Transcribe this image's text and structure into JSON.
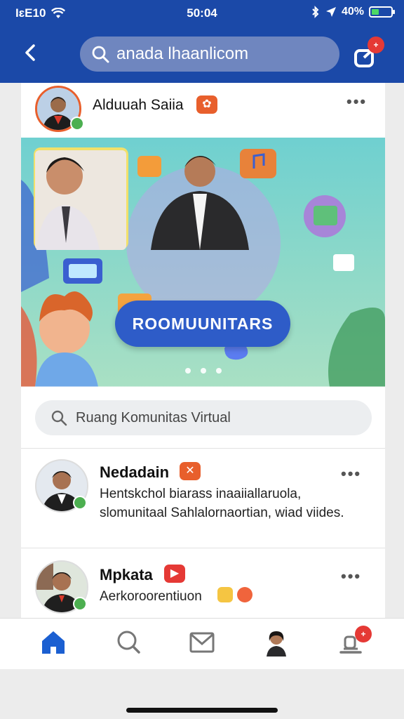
{
  "status_bar": {
    "carrier": "IɛE10",
    "time": "50:04",
    "battery": "40%",
    "battery_level": 0.4
  },
  "header": {
    "search_text": "anada lhaanlicom"
  },
  "post": {
    "author": "Alduuah Saiia",
    "banner_title": "ROOMUUNITARS",
    "carousel_dots": 3
  },
  "community_search": {
    "text": "Ruang Komunitas Virtual"
  },
  "comments": [
    {
      "name": "Nedadain",
      "text": "Hentskchol biarass inaaiiallaruola, slomunitaal Sahlalornaortian, wiad viides."
    },
    {
      "name": "Mpkata",
      "text": "Aerkoroorentiuon"
    }
  ],
  "tabbar": {
    "items": [
      "home",
      "search",
      "messages",
      "profile",
      "notifications"
    ]
  },
  "colors": {
    "header": "#1b49a8",
    "accent": "#e85f2c",
    "online": "#4caf50",
    "tab_active": "#1b5fd1"
  }
}
